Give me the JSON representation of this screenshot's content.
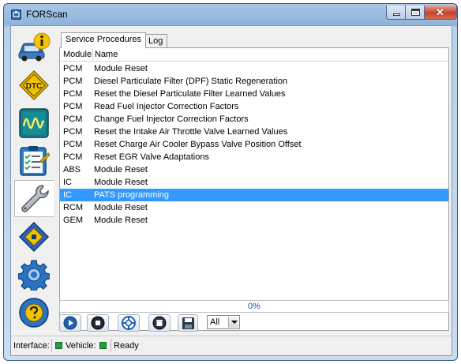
{
  "window": {
    "title": "FORScan",
    "close_glyph": "✕"
  },
  "sidebar": {
    "items": [
      {
        "name": "vehicle-info",
        "icon": "car-info-icon"
      },
      {
        "name": "dtc",
        "icon": "dtc-icon",
        "label": "DTC"
      },
      {
        "name": "oscilloscope",
        "icon": "oscilloscope-icon"
      },
      {
        "name": "tests",
        "icon": "checklist-icon"
      },
      {
        "name": "service",
        "icon": "wrench-icon",
        "active": true
      },
      {
        "name": "configuration",
        "icon": "chip-icon"
      },
      {
        "name": "settings",
        "icon": "gear-icon"
      },
      {
        "name": "help",
        "icon": "help-icon"
      }
    ]
  },
  "tabs": [
    {
      "label": "Service Procedures",
      "active": true
    },
    {
      "label": "Log",
      "active": false
    }
  ],
  "table": {
    "columns": [
      "Module",
      "Name"
    ],
    "rows": [
      {
        "module": "PCM",
        "name": "Module Reset"
      },
      {
        "module": "PCM",
        "name": "Diesel Particulate Filter (DPF) Static Regeneration"
      },
      {
        "module": "PCM",
        "name": "Reset the Diesel Particulate Filter Learned Values"
      },
      {
        "module": "PCM",
        "name": "Read Fuel Injector Correction Factors"
      },
      {
        "module": "PCM",
        "name": "Change Fuel Injector Correction Factors"
      },
      {
        "module": "PCM",
        "name": "Reset the Intake Air Throttle Valve Learned Values"
      },
      {
        "module": "PCM",
        "name": "Reset Charge Air Cooler Bypass Valve Position Offset"
      },
      {
        "module": "PCM",
        "name": "Reset EGR Valve Adaptations"
      },
      {
        "module": "ABS",
        "name": "Module Reset"
      },
      {
        "module": "IC",
        "name": "Module Reset"
      },
      {
        "module": "IC",
        "name": "PATS programming",
        "selected": true
      },
      {
        "module": "RCM",
        "name": "Module Reset"
      },
      {
        "module": "GEM",
        "name": "Module Reset"
      }
    ]
  },
  "progress": {
    "value": 0,
    "label": "0%"
  },
  "toolbar": {
    "buttons": [
      "play-icon",
      "stop-icon",
      "lifebuoy-icon",
      "clear-icon",
      "save-icon"
    ],
    "filter": {
      "value": "All"
    }
  },
  "status": {
    "interface_label": "Interface:",
    "vehicle_label": "Vehicle:",
    "state": "Ready",
    "led_color": "#1e9e3c"
  },
  "colors": {
    "selection": "#3399ff",
    "accent": "#2e66a8"
  }
}
